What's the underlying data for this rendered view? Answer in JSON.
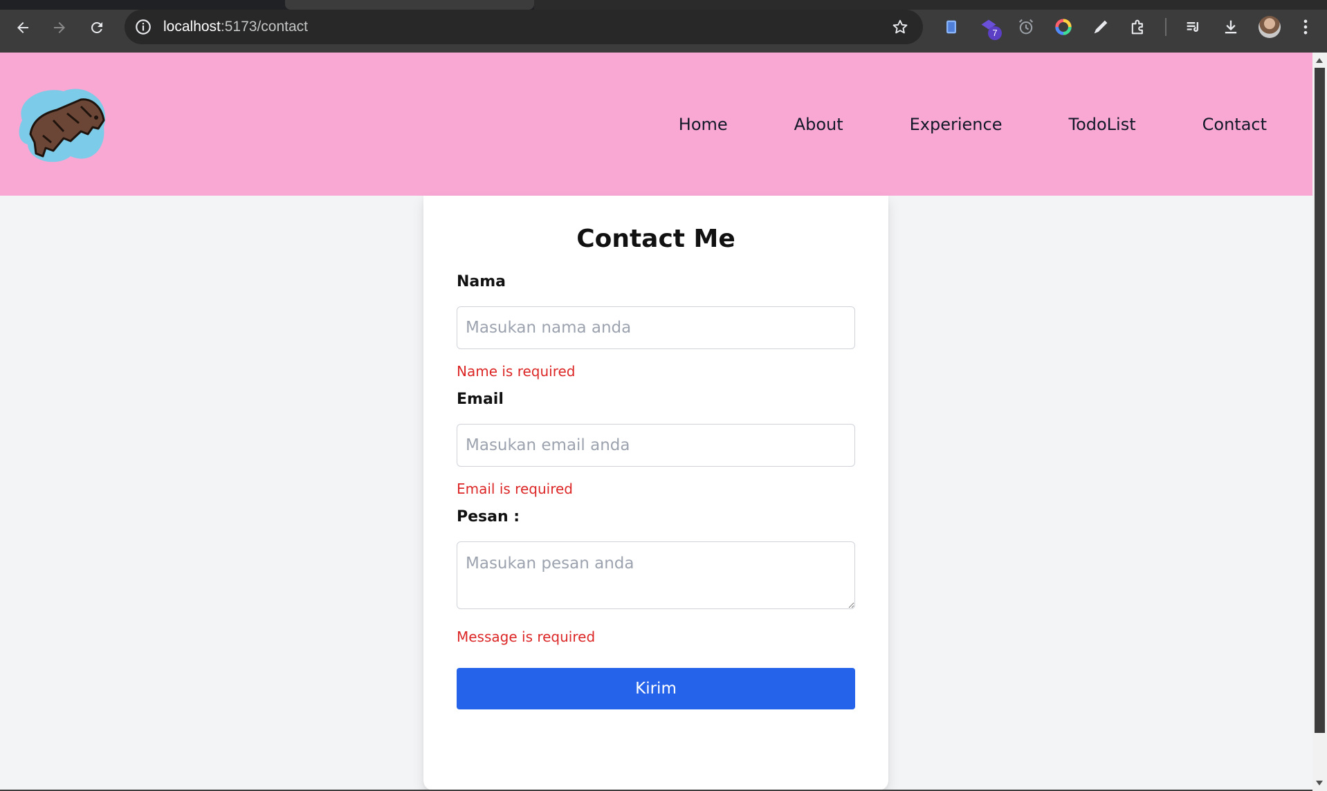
{
  "browser": {
    "url_host": "localhost",
    "url_rest": ":5173/contact",
    "extension_badge": "7"
  },
  "nav": {
    "items": [
      "Home",
      "About",
      "Experience",
      "TodoList",
      "Contact"
    ]
  },
  "form": {
    "title": "Contact Me",
    "name_label": "Nama",
    "name_placeholder": "Masukan nama anda",
    "name_error": "Name is required",
    "email_label": "Email",
    "email_placeholder": "Masukan email anda",
    "email_error": "Email is required",
    "message_label": "Pesan :",
    "message_placeholder": "Masukan pesan anda",
    "message_error": "Message is required",
    "submit_label": "Kirim"
  },
  "colors": {
    "header_bg": "#f9a8d4",
    "button_bg": "#2563eb",
    "error_text": "#dc2626",
    "page_bg": "#f3f4f6"
  },
  "icons": {
    "back": "back-arrow-icon",
    "forward": "forward-arrow-icon",
    "reload": "reload-icon",
    "site_info": "info-icon",
    "bookmark": "star-icon",
    "logo": "animal-logo"
  }
}
